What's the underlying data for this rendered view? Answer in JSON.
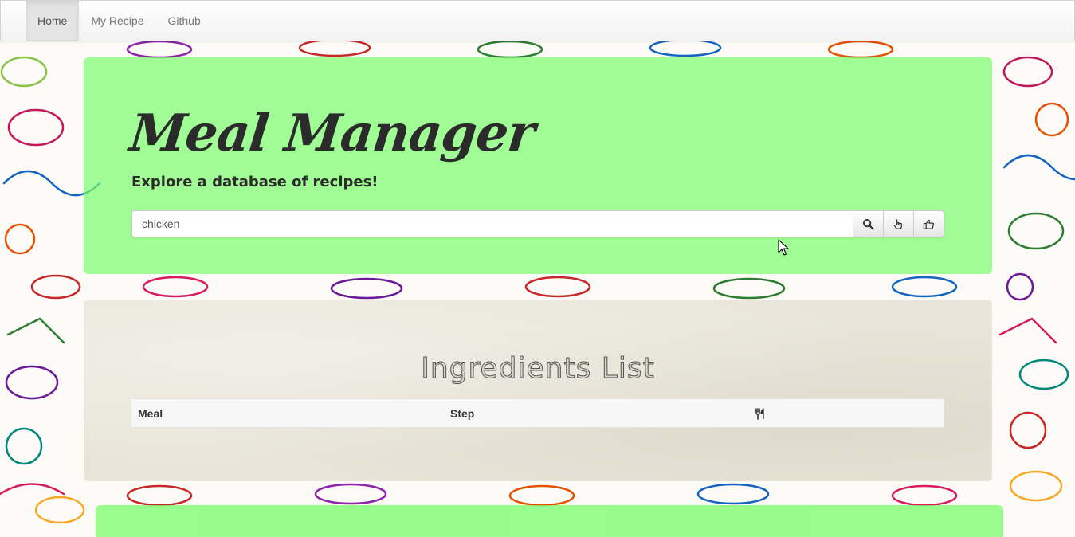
{
  "nav": {
    "items": [
      {
        "label": "Home",
        "active": true
      },
      {
        "label": "My Recipe",
        "active": false
      },
      {
        "label": "Github",
        "active": false
      }
    ]
  },
  "hero": {
    "title": "Meal Manager",
    "subtitle": "Explore a database of recipes!",
    "search": {
      "value": "chicken",
      "buttons": [
        "search-icon",
        "hand-pointer-icon",
        "thumbs-up-icon"
      ]
    }
  },
  "ingredients": {
    "title": "Ingredients List",
    "columns": [
      "Meal",
      "Step"
    ],
    "last_column_icon": "utensils-icon"
  },
  "colors": {
    "hero_bg": "#7cfc6e",
    "panel_bg": "#e9e6d9"
  }
}
